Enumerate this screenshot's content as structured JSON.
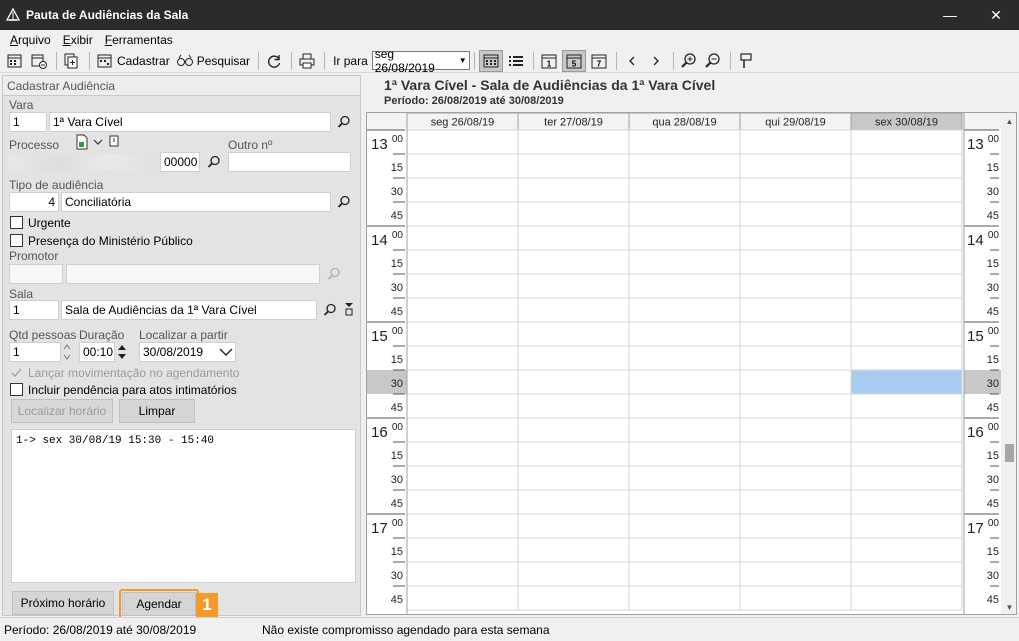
{
  "window": {
    "title": "Pauta de Audiências da Sala",
    "minimize": "—",
    "close": "✕"
  },
  "menu": {
    "items": [
      {
        "label": "Arquivo",
        "key": "A"
      },
      {
        "label": "Exibir",
        "key": "E"
      },
      {
        "label": "Ferramentas",
        "key": "F"
      }
    ]
  },
  "toolbar": {
    "cadastrar_label": "Cadastrar",
    "pesquisar_label": "Pesquisar",
    "goto_label": "Ir para",
    "goto_date": "seg 26/08/2019"
  },
  "form": {
    "header": "Cadastrar Audiência",
    "vara": {
      "label": "Vara",
      "code": "1",
      "name": "1ª Vara Cível"
    },
    "processo": {
      "label": "Processo",
      "suffix": "00000",
      "outro_label": "Outro nº",
      "outro_value": ""
    },
    "tipo": {
      "label": "Tipo de audiência",
      "code": "4",
      "name": "Conciliatória"
    },
    "urgente": {
      "label": "Urgente",
      "checked": false
    },
    "presenca_mp": {
      "label": "Presença do Ministério Público",
      "checked": false
    },
    "promotor": {
      "label": "Promotor",
      "code": "",
      "name": ""
    },
    "sala": {
      "label": "Sala",
      "code": "1",
      "name": "Sala de Audiências da 1ª Vara Cível"
    },
    "qtd": {
      "label": "Qtd pessoas",
      "value": "1"
    },
    "duracao": {
      "label": "Duração",
      "value": "00:10"
    },
    "localizar": {
      "label": "Localizar a partir",
      "value": "30/08/2019"
    },
    "lancar_mov": {
      "label": "Lançar movimentação no agendamento",
      "checked": true,
      "disabled": true
    },
    "incluir_pend": {
      "label": "Incluir pendência para atos intimatórios",
      "checked": false
    },
    "btn_localizar": "Localizar horário",
    "btn_limpar": "Limpar",
    "results": [
      "1-> sex 30/08/19 15:30 - 15:40"
    ],
    "btn_proximo": "Próximo horário",
    "btn_agendar": "Agendar",
    "callout_number": "1"
  },
  "calendar": {
    "title": "1ª Vara Cível - Sala de Audiências da 1ª Vara Cível",
    "period": "Período: 26/08/2019 até 30/08/2019",
    "days": [
      "seg 26/08/19",
      "ter 27/08/19",
      "qua 28/08/19",
      "qui 29/08/19",
      "sex 30/08/19"
    ],
    "selected_day_index": 4,
    "hours": [
      "13",
      "14",
      "15",
      "16",
      "17"
    ],
    "minutes": [
      "00",
      "15",
      "30",
      "45"
    ],
    "selected_slot": {
      "hour": "15",
      "minute": "30",
      "day_index": 4
    },
    "colors": {
      "selected_slot": "#a8cdf0",
      "selected_time": "#c8c8c8",
      "callout": "#f39a2b"
    }
  },
  "status": {
    "period": "Período: 26/08/2019 até 30/08/2019",
    "message": "Não existe compromisso agendado para esta semana"
  }
}
